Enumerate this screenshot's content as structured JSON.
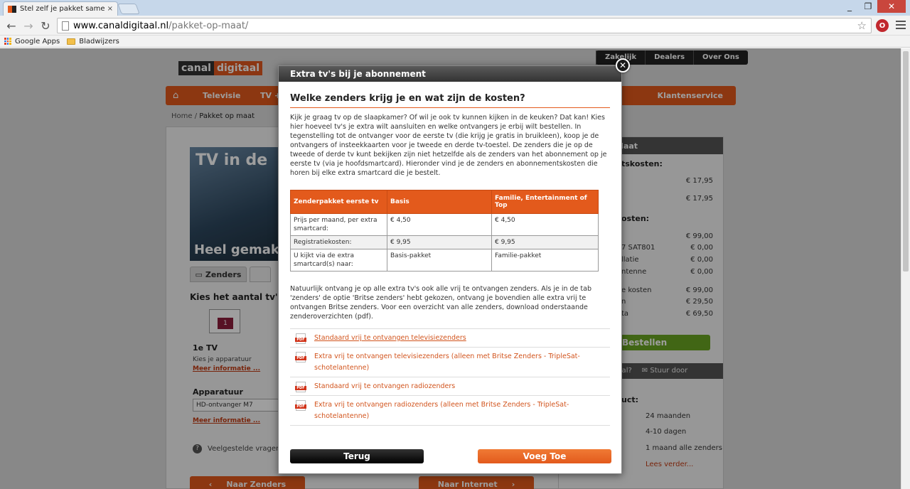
{
  "browser": {
    "tab_title": "Stel zelf je pakket samen m",
    "tab_close": "×",
    "url_host": "www.canaldigitaal.nl",
    "url_path": "/pakket-op-maat/",
    "bookmarks": [
      "Google Apps",
      "Bladwijzers"
    ],
    "window_controls": [
      "_",
      "❐",
      "✕"
    ],
    "ext_badge": "O"
  },
  "site": {
    "logo_left": "canal",
    "logo_right": "digitaal",
    "top_nav": [
      "Zakelijk",
      "Dealers",
      "Over Ons"
    ],
    "main_nav": [
      "Televisie",
      "TV +",
      "Klantenservice"
    ],
    "breadcrumb_home": "Home",
    "breadcrumb_sep": " / ",
    "breadcrumb_current": "Pakket op maat",
    "banner_top": "TV in de",
    "banner_bottom": "Heel gemak",
    "tab_zenders": "Zenders",
    "kies_title": "Kies het aantal tv's e",
    "tv_number": "1",
    "first_tv": "1e TV",
    "kies_apparatuur": "Kies je apparatuur",
    "meer_info": "Meer informatie ...",
    "apparatuur_title": "Apparatuur",
    "apparatuur_value": "HD-ontvanger M7",
    "faq": "Veelgestelde vragen o",
    "btn_prev": "Naar Zenders",
    "btn_next": "Naar Internet"
  },
  "summary": {
    "header": "Maat",
    "section1": "tskosten:",
    "rows1": [
      {
        "label": "",
        "price": "€  17,95"
      },
      {
        "label": "",
        "price": "€  17,95"
      }
    ],
    "section2": "osten:",
    "rows2": [
      {
        "label": "",
        "price": "€  99,00"
      },
      {
        "label": "7 SAT801",
        "price": "€    0,00"
      },
      {
        "label": "llatie",
        "price": "€    0,00"
      },
      {
        "label": "ntenne",
        "price": "€    0,00"
      }
    ],
    "rows3": [
      {
        "label": "e kosten",
        "price": "€  99,00"
      },
      {
        "label": "n",
        "price": "€  29,50"
      },
      {
        "label": "ta",
        "price": "€  69,50"
      }
    ],
    "bestellen": "Bestellen",
    "share_left": "alDigitaal?",
    "share_right": "Stuur door",
    "section3": "uct:",
    "rows4": [
      "24 maanden",
      "4-10 dagen",
      "1 maand alle zenders"
    ],
    "lees_verder": "Lees verder..."
  },
  "modal": {
    "header": "Extra tv's bij je abonnement",
    "close": "✕",
    "title": "Welke zenders krijg je en wat zijn de kosten?",
    "intro": "Kijk je graag tv op de slaapkamer? Of wil je ook tv kunnen kijken in de keuken? Dat kan! Kies hier hoeveel tv's je extra wilt aansluiten en welke ontvangers je erbij wilt bestellen. In tegenstelling tot de ontvanger voor de eerste tv (die krijg je gratis in bruikleen), koop je de ontvangers of insteekkaarten voor je tweede en derde tv-toestel. De zenders die je op de tweede of derde tv kunt bekijken zijn niet hetzelfde als de zenders van het abonnement op je eerste tv (via je hoofdsmartcard). Hieronder vind je de zenders en abonnementskosten die horen bij elke extra smartcard die je bestelt.",
    "table": {
      "headers": [
        "Zenderpakket eerste tv",
        "Basis",
        "Familie, Entertainment of Top"
      ],
      "rows": [
        [
          "Prijs per maand, per extra smartcard:",
          "€ 4,50",
          "€ 4,50"
        ],
        [
          "Registratiekosten:",
          "€ 9,95",
          "€ 9,95"
        ],
        [
          "U kijkt via de extra smartcard(s) naar:",
          "Basis-pakket",
          "Familie-pakket"
        ]
      ]
    },
    "outro": "Natuurlijk ontvang je op alle extra tv's ook alle vrij te ontvangen zenders. Als je in de tab 'zenders' de optie 'Britse zenders' hebt gekozen, ontvang je bovendien alle extra vrij te ontvangen Britse zenders. Voor een overzicht van alle zenders, download onderstaande zenderoverzichten (pdf).",
    "downloads": [
      "Standaard vrij te ontvangen televisiezenders",
      "Extra vrij te ontvangen televisiezenders (alleen met Britse Zenders - TripleSat-schotelantenne)",
      "Standaard vrij te ontvangen radiozenders",
      "Extra vrij te ontvangen radiozenders (alleen met Britse Zenders - TripleSat-schotelantenne)"
    ],
    "pdf_label": "PDF",
    "btn_back": "Terug",
    "btn_add": "Voeg Toe"
  }
}
